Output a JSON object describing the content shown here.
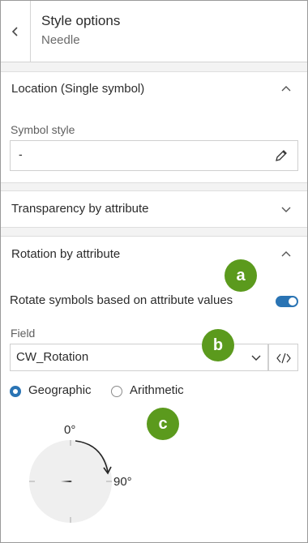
{
  "header": {
    "title": "Style options",
    "subtitle": "Needle"
  },
  "location": {
    "title": "Location (Single symbol)",
    "symbol_style_label": "Symbol style",
    "symbol_preview": "-"
  },
  "transparency": {
    "title": "Transparency by attribute"
  },
  "rotation": {
    "title": "Rotation by attribute",
    "toggle_label": "Rotate symbols based on attribute values",
    "toggle_on": true,
    "field_label": "Field",
    "field_value": "CW_Rotation",
    "radio_geographic": "Geographic",
    "radio_arithmetic": "Arithmetic",
    "selected_mode": "Geographic",
    "dial_top_label": "0°",
    "dial_right_label": "90°"
  },
  "callouts": {
    "a": "a",
    "b": "b",
    "c": "c"
  },
  "colors": {
    "accent": "#2a74b4",
    "callout": "#5b9a1d",
    "panel_bg": "#ffffff",
    "page_bg": "#f3f3f3"
  }
}
